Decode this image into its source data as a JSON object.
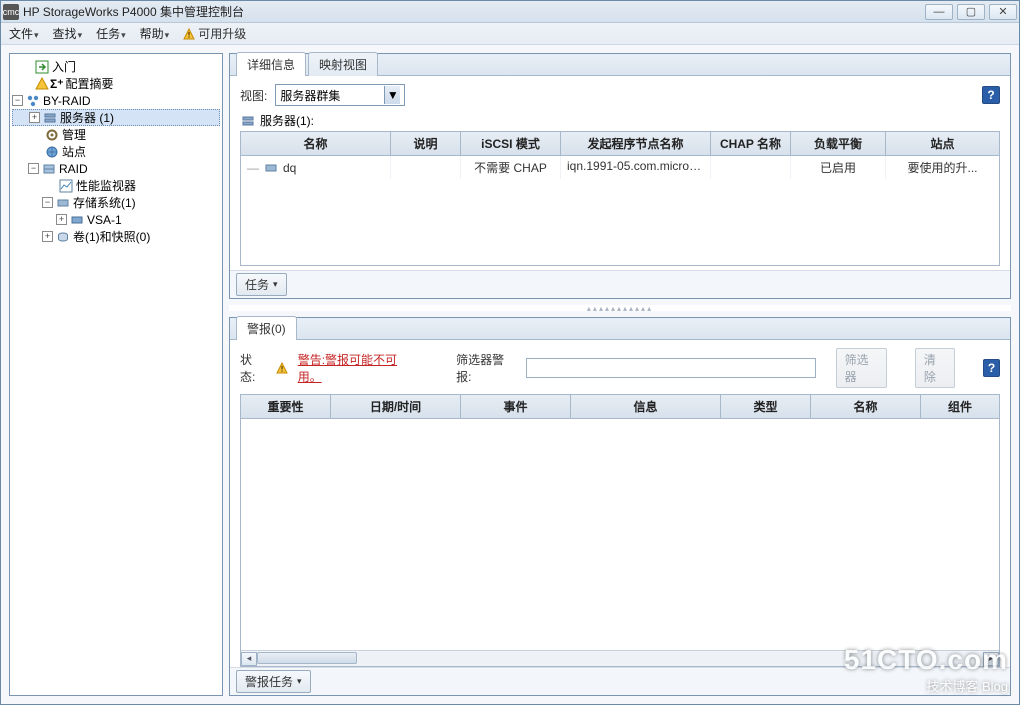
{
  "window": {
    "title": "HP StorageWorks P4000 集中管理控制台"
  },
  "menu": {
    "file": "文件",
    "find": "查找",
    "tasks": "任务",
    "help": "帮助",
    "upgrade": "可用升级"
  },
  "tree": {
    "intro": "入门",
    "config_summary": "配置摘要",
    "by_raid": "BY-RAID",
    "servers": "服务器 (1)",
    "management": "管理",
    "sites": "站点",
    "raid": "RAID",
    "perf_monitor": "性能监视器",
    "storage_sys": "存储系统(1)",
    "vsa": "VSA-1",
    "volumes": "卷(1)和快照(0)"
  },
  "tabs": {
    "details": "详细信息",
    "mapview": "映射视图"
  },
  "view": {
    "label": "视图:",
    "value": "服务器群集"
  },
  "servers_header": "服务器(1):",
  "server_cols": {
    "name": "名称",
    "desc": "说明",
    "iscsi": "iSCSI 模式",
    "initiator": "发起程序节点名称",
    "chap": "CHAP 名称",
    "lb": "负载平衡",
    "site": "站点"
  },
  "server_row": {
    "name": "dq",
    "desc": "",
    "iscsi": "不需要 CHAP",
    "initiator": "iqn.1991-05.com.micros...",
    "chap": "",
    "lb": "已启用",
    "site": "要使用的升..."
  },
  "tasks_btn": "任务",
  "alarms": {
    "tab": "警报(0)",
    "status_label": "状态:",
    "status_warn": "警告:警报可能不可用。",
    "filter_label": "筛选器警报:",
    "filter_btn": "筛选器",
    "clear_btn": "清除",
    "cols": {
      "sev": "重要性",
      "dt": "日期/时间",
      "event": "事件",
      "info": "信息",
      "type": "类型",
      "name": "名称",
      "comp": "组件"
    },
    "tasks_btn": "警报任务"
  },
  "help": "?",
  "watermark": {
    "big": "51CTO.com",
    "sub": "技术博客   Blog"
  }
}
